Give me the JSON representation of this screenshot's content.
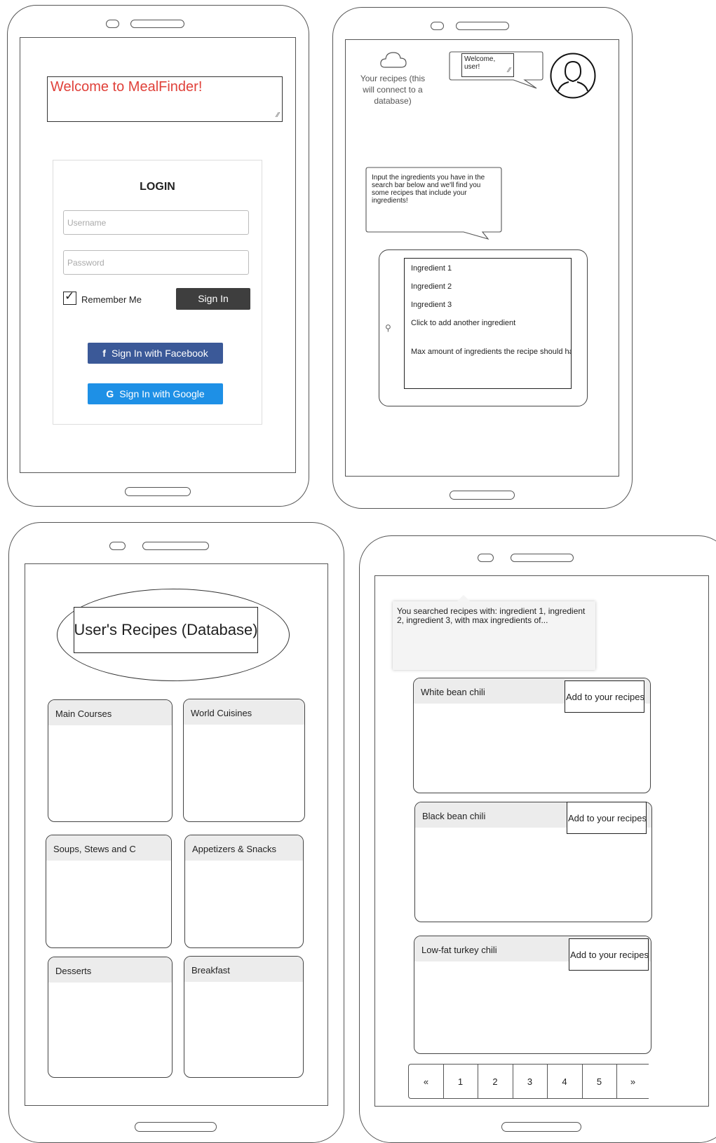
{
  "login_screen": {
    "welcome_text": "Welcome to MealFinder!",
    "login_heading": "LOGIN",
    "username_placeholder": "Username",
    "password_placeholder": "Password",
    "remember_me_label": "Remember Me",
    "sign_in_button": "Sign In",
    "facebook_button": "Sign In with Facebook",
    "google_button": "Sign In with Google",
    "colors": {
      "welcome": "#e0413a",
      "sign_in": "#3e3e3e",
      "facebook": "#3b5998",
      "google": "#1e90e6"
    }
  },
  "search_screen": {
    "cloud_caption": "Your recipes (this will connect to a database)",
    "welcome_bubble": "Welcome, user!",
    "instructions_bubble": "Input the ingredients you have in the search bar below and we'll find you some recipes that include your ingredients!",
    "search_items": [
      "Ingredient 1",
      "Ingredient 2",
      "Ingredient 3",
      "Click to add another ingredient",
      "Max amount of ingredients the recipe should have"
    ]
  },
  "recipes_db_screen": {
    "title": "User's Recipes (Database)",
    "categories": [
      "Main Courses",
      "World Cuisines",
      "Soups, Stews and C",
      "Appetizers & Snacks",
      "Desserts",
      "Breakfast"
    ]
  },
  "results_screen": {
    "search_summary": "You searched recipes with: ingredient 1, ingredient 2, ingredient 3, with max ingredients of...",
    "add_button_label": "Add to your recipes",
    "results": [
      {
        "name": "White bean chili"
      },
      {
        "name": "Black bean chili"
      },
      {
        "name": "Low-fat turkey chili"
      }
    ],
    "pagination": [
      "«",
      "1",
      "2",
      "3",
      "4",
      "5",
      "»"
    ]
  }
}
